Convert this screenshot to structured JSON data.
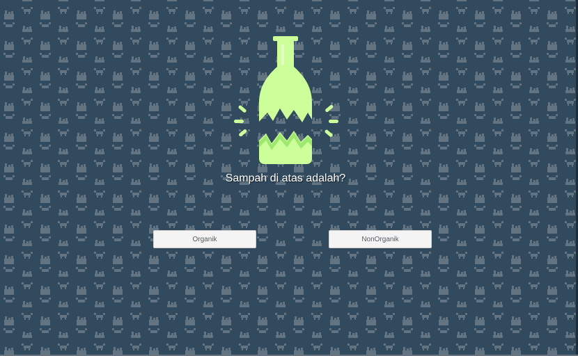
{
  "game": {
    "question": "Sampah di atas adalah?",
    "item_icon": "broken-bottle-icon",
    "answers": [
      {
        "label": "Organik"
      },
      {
        "label": "NonOrganik"
      }
    ]
  },
  "colors": {
    "background": "#324a5e",
    "pattern": "#6b7a88",
    "bottle": "#ccff99",
    "bottle_shadow": "#9ee86f",
    "button": "#f4f4f4",
    "button_text": "#555b63",
    "question_text": "#ffffff"
  }
}
